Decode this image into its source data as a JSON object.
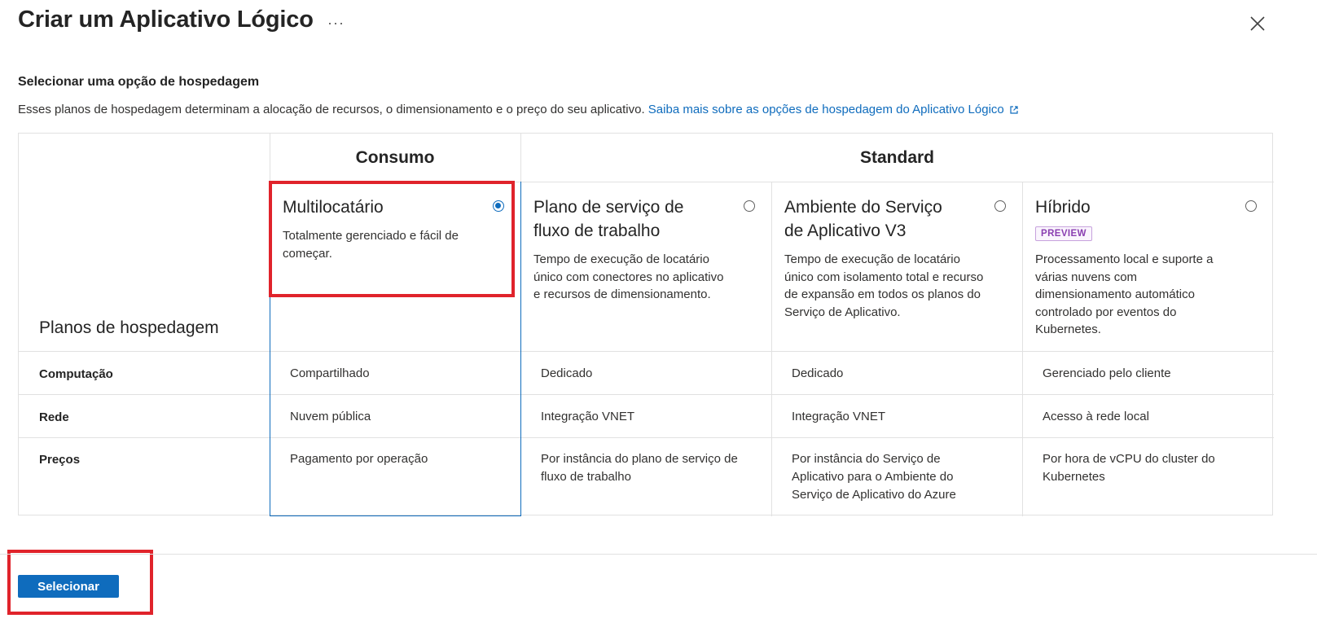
{
  "header": {
    "title": "Criar um Aplicativo Lógico",
    "more_icon": "ellipsis-icon",
    "close_icon": "close-icon"
  },
  "intro": {
    "section_title": "Selecionar uma opção de hospedagem",
    "description": "Esses planos de hospedagem determinam a alocação de recursos, o dimensionamento e o preço do seu aplicativo.",
    "learn_more_link": "Saiba mais sobre as opções de hospedagem do Aplicativo Lógico"
  },
  "table": {
    "groups": [
      "Consumo",
      "Standard"
    ],
    "row_header": "Planos de hospedagem",
    "plans": [
      {
        "title": "Multilocatário",
        "description": "Totalmente gerenciado e fácil de começar.",
        "selected": true
      },
      {
        "title": "Plano de serviço de fluxo de trabalho",
        "description": "Tempo de execução de locatário único com conectores no aplicativo e recursos de dimensionamento.",
        "selected": false
      },
      {
        "title": "Ambiente do Serviço de Aplicativo V3",
        "description": "Tempo de execução de locatário único com isolamento total e recurso de expansão em todos os planos do Serviço de Aplicativo.",
        "selected": false
      },
      {
        "title": "Híbrido",
        "badge": "PREVIEW",
        "description": "Processamento local e suporte a várias nuvens com dimensionamento automático controlado por eventos do Kubernetes.",
        "selected": false
      }
    ],
    "rows": [
      {
        "label": "Computação",
        "values": [
          "Compartilhado",
          "Dedicado",
          "Dedicado",
          "Gerenciado pelo cliente"
        ]
      },
      {
        "label": "Rede",
        "values": [
          "Nuvem pública",
          "Integração VNET",
          "Integração VNET",
          "Acesso à rede local"
        ]
      },
      {
        "label": "Preços",
        "values": [
          "Pagamento por operação",
          "Por instância do plano de serviço de fluxo de trabalho",
          "Por instância do Serviço de Aplicativo para o Ambiente do Serviço de Aplicativo do Azure",
          "Por hora de vCPU do cluster do Kubernetes"
        ]
      }
    ]
  },
  "footer": {
    "select_button": "Selecionar"
  },
  "colors": {
    "accent": "#0f6cbd",
    "highlight": "#e0232b",
    "preview_badge": "#8a3fb1"
  }
}
